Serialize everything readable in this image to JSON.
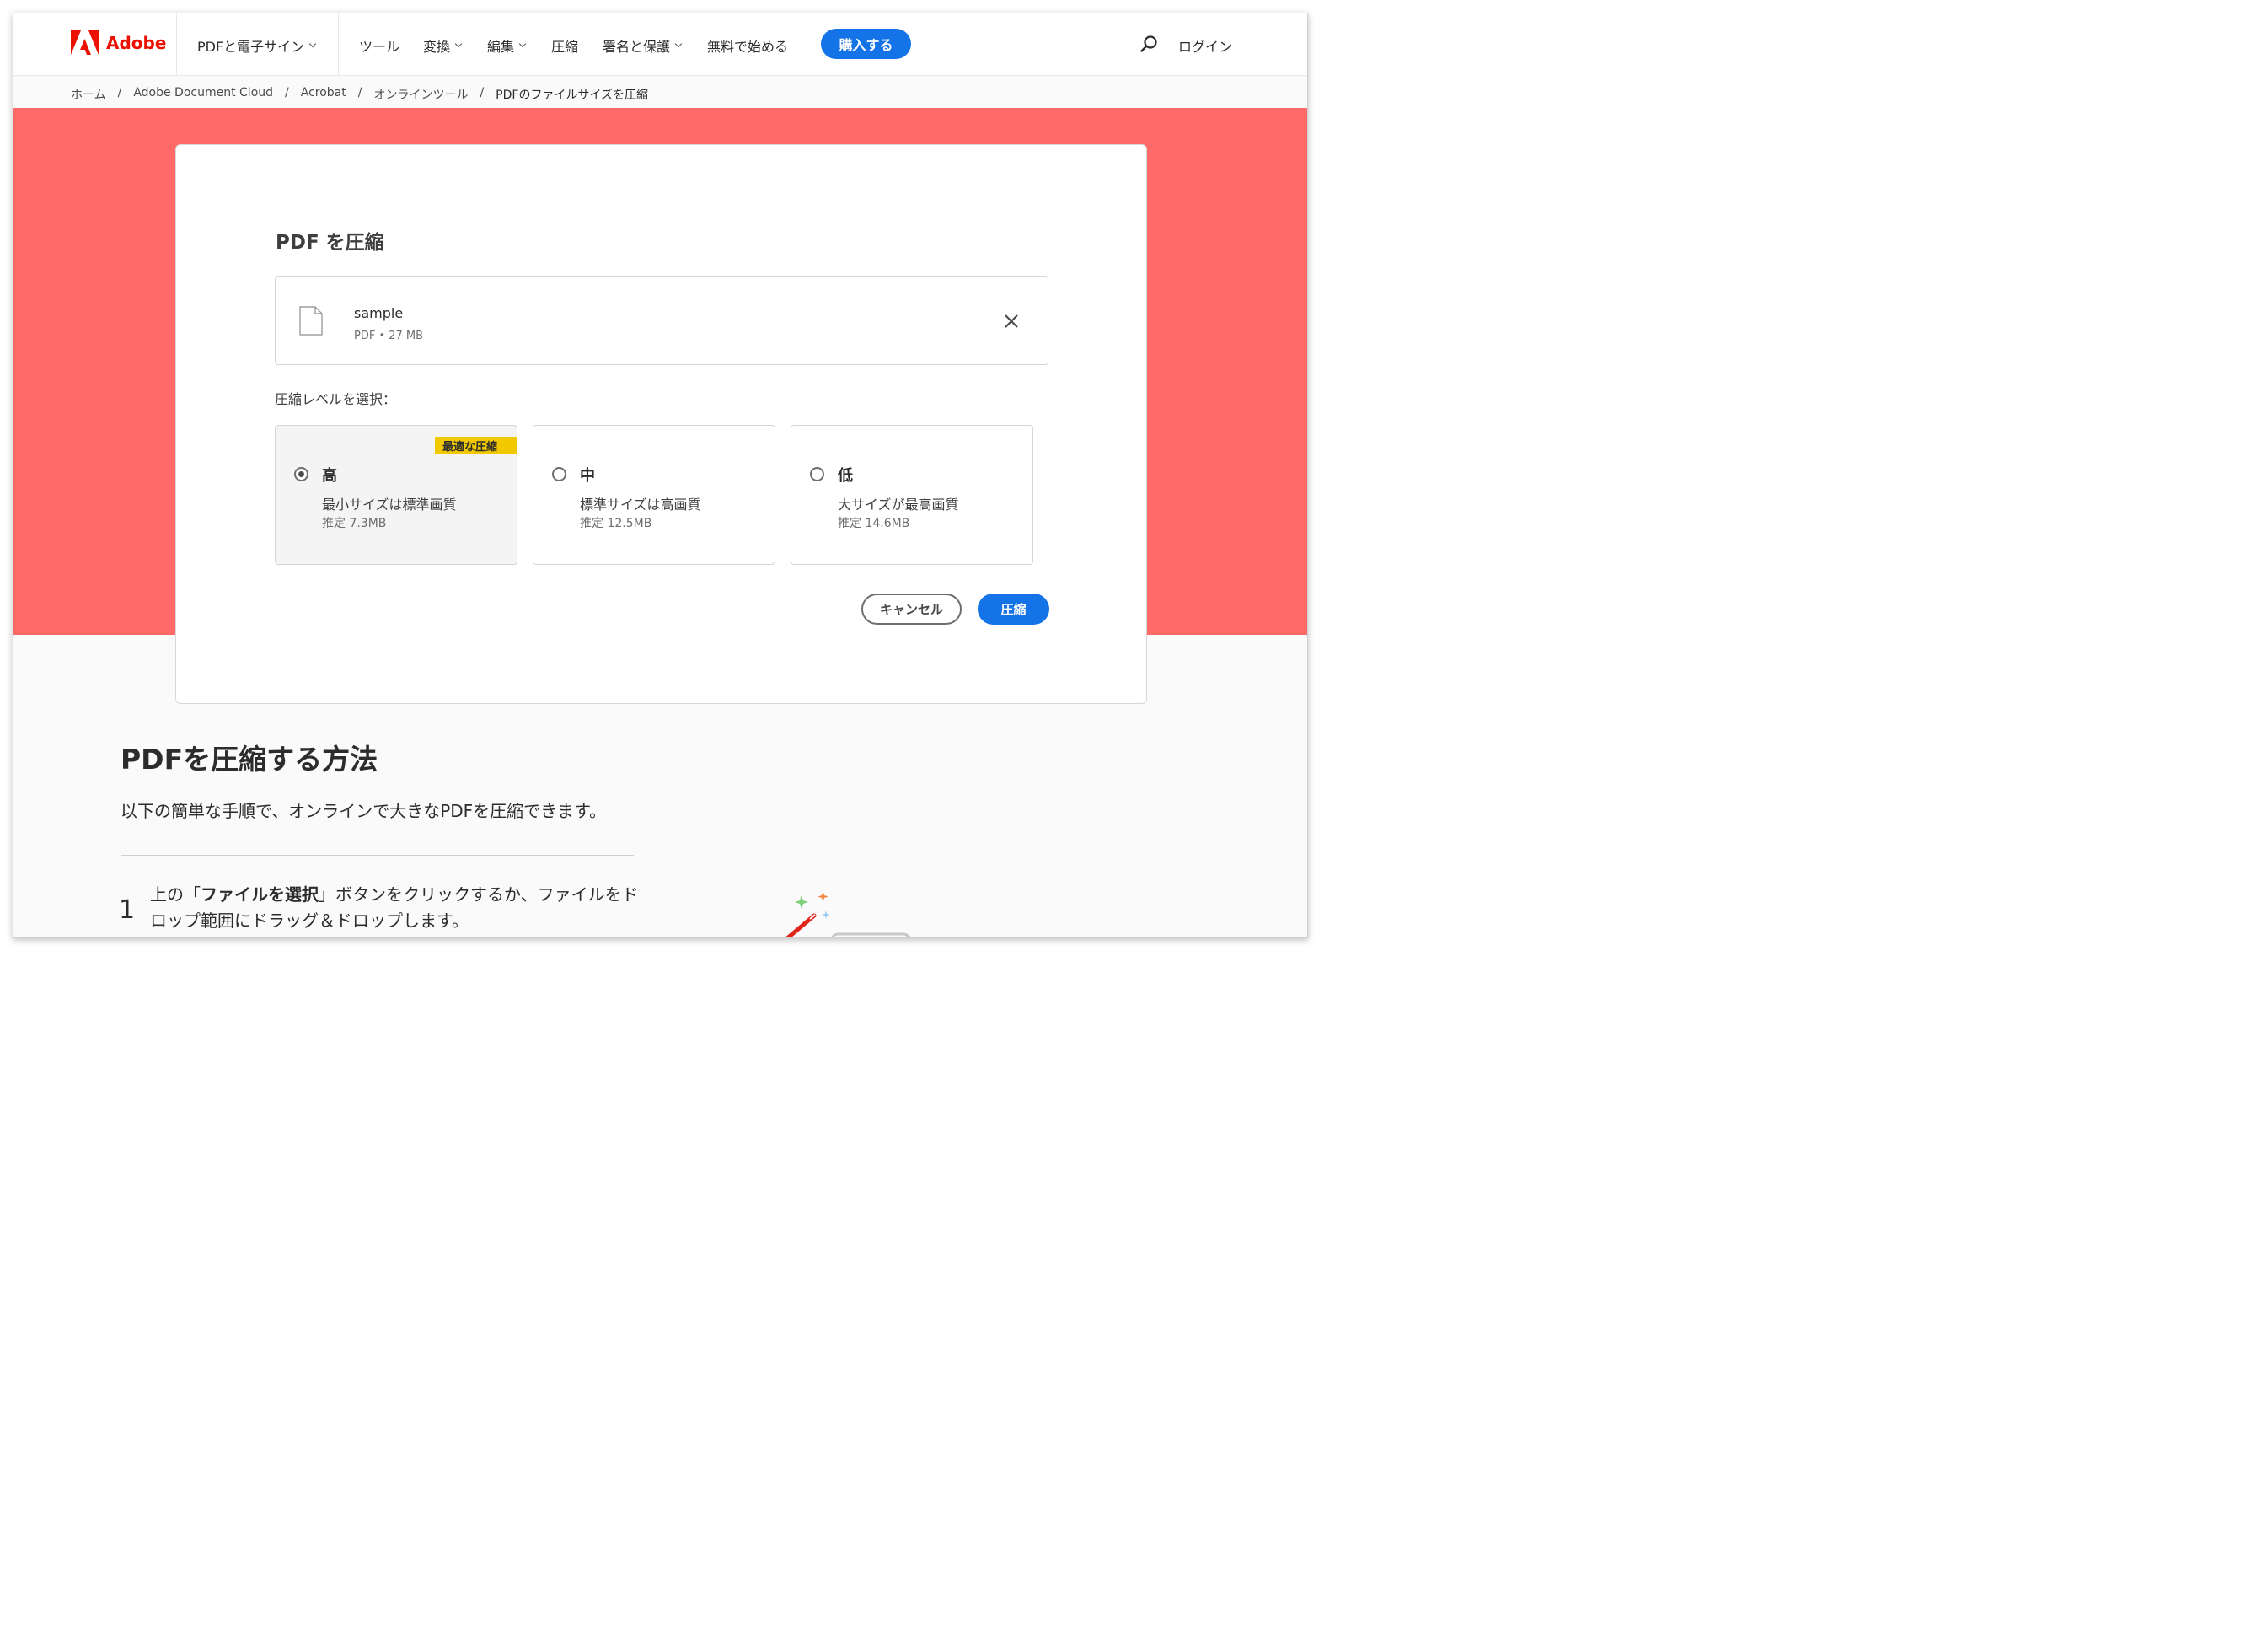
{
  "header": {
    "brand": "Adobe",
    "nav": [
      {
        "label": "PDFと電子サイン",
        "dropdown": true
      },
      {
        "label": "ツール",
        "dropdown": false
      },
      {
        "label": "変換",
        "dropdown": true
      },
      {
        "label": "編集",
        "dropdown": true
      },
      {
        "label": "圧縮",
        "dropdown": false
      },
      {
        "label": "署名と保護",
        "dropdown": true
      },
      {
        "label": "無料で始める",
        "dropdown": false
      }
    ],
    "buy_label": "購入する",
    "login_label": "ログイン"
  },
  "breadcrumb": [
    "ホーム",
    "Adobe Document Cloud",
    "Acrobat",
    "オンラインツール",
    "PDFのファイルサイズを圧縮"
  ],
  "breadcrumb_separator": "/",
  "card": {
    "title": "PDF を圧縮",
    "file": {
      "name": "sample",
      "meta": "PDF • 27 MB"
    },
    "level_label": "圧縮レベルを選択：",
    "options": [
      {
        "title": "高",
        "desc": "最小サイズは標準画質",
        "estimate": "推定 7.3MB",
        "selected": true,
        "badge": "最適な圧縮"
      },
      {
        "title": "中",
        "desc": "標準サイズは高画質",
        "estimate": "推定 12.5MB",
        "selected": false
      },
      {
        "title": "低",
        "desc": "大サイズが最高画質",
        "estimate": "推定 14.6MB",
        "selected": false
      }
    ],
    "cancel_label": "キャンセル",
    "compress_label": "圧縮"
  },
  "how": {
    "title": "PDFを圧縮する方法",
    "subtitle": "以下の簡単な手順で、オンラインで大きなPDFを圧縮できます。",
    "step1": {
      "number": "1",
      "prefix": "上の「",
      "bold": "ファイルを選択",
      "suffix": "」ボタンをクリックするか、ファイルをドロップ範囲にドラッグ＆ドロップします。"
    }
  },
  "colors": {
    "brand_red": "#eb1000",
    "hero_bg": "#ff6a68",
    "primary_blue": "#1473e6",
    "badge_yellow": "#f2c800"
  }
}
